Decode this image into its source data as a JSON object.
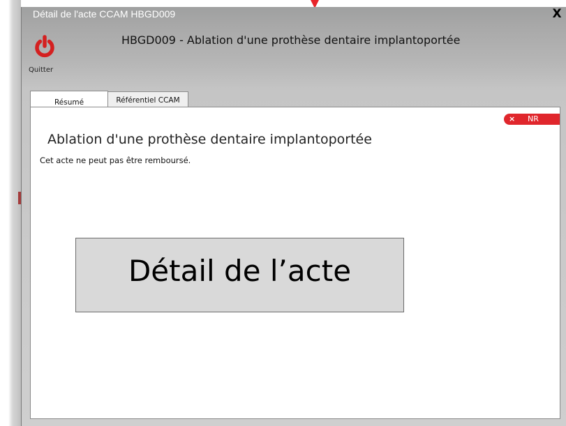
{
  "window": {
    "title": "Détail de l'acte CCAM HBGD009",
    "close_symbol": "X"
  },
  "toolbar": {
    "quit_label": "Quitter",
    "quit_icon": "power-icon",
    "header_title": "HBGD009 - Ablation  d'une prothèse dentaire implantoportée"
  },
  "tabs": [
    {
      "label": "Résumé",
      "active": true
    },
    {
      "label": "Référentiel CCAM",
      "active": false
    }
  ],
  "badge": {
    "icon": "×",
    "label": "NR",
    "color": "#e0262c"
  },
  "content": {
    "title": "Ablation d'une prothèse dentaire implantoportée",
    "note": "Cet acte ne peut pas être remboursé."
  },
  "callout": {
    "text": "Détail de l’acte"
  },
  "colors": {
    "accent_red": "#e0262c",
    "quit_icon_red": "#d42020"
  }
}
